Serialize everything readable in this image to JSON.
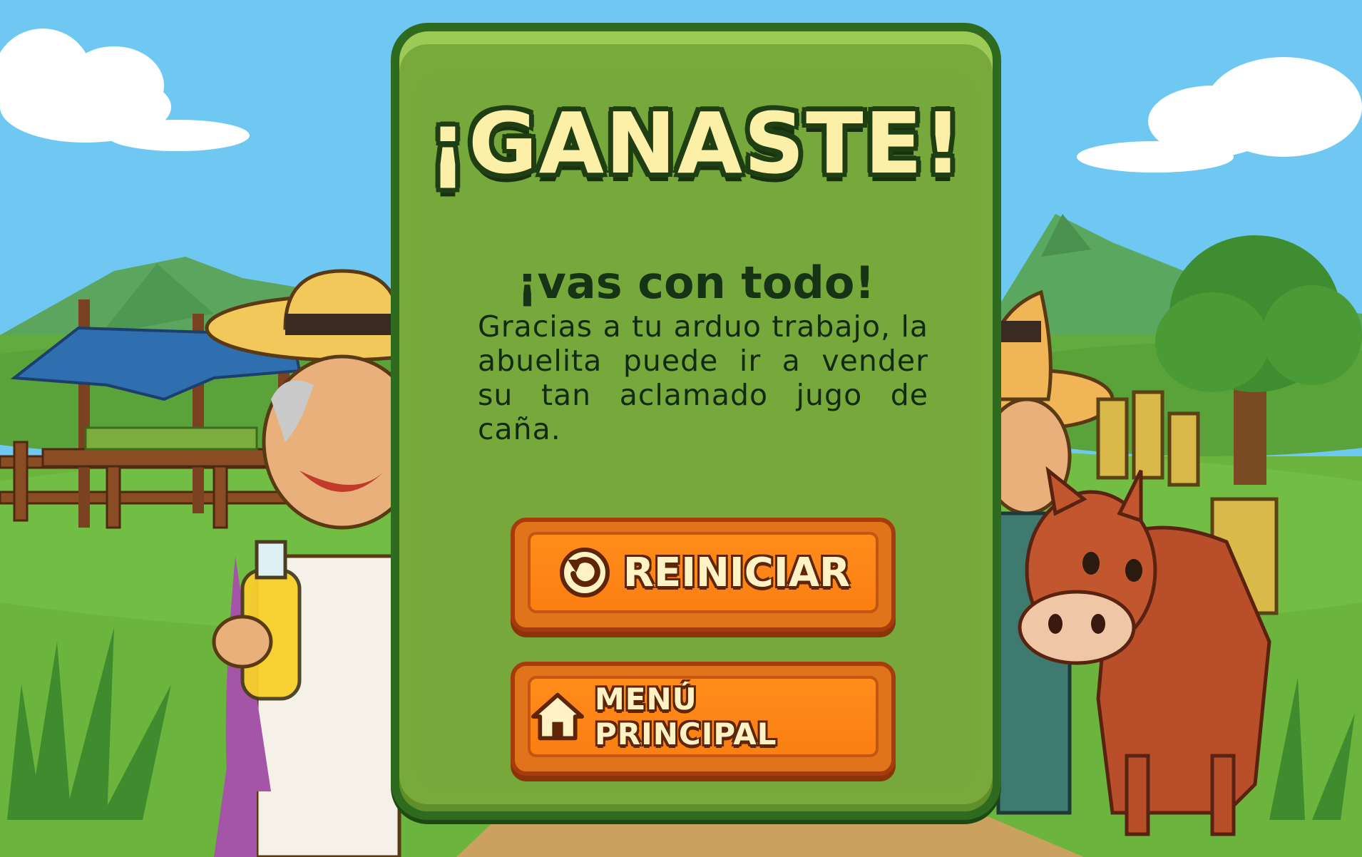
{
  "end_screen": {
    "title": "¡GANASTE!",
    "subtitle": "¡vas con todo!",
    "message": "Gracias a tu arduo trabajo, la abuelita puede ir a vender su tan aclamado jugo de caña."
  },
  "buttons": {
    "restart": {
      "label": "REINICIAR",
      "icon": "restart-icon"
    },
    "main_menu": {
      "label": "MENÚ PRINCIPAL",
      "icon": "home-icon"
    }
  },
  "colors": {
    "sky": "#6cc7f0",
    "panel": "#78a93a",
    "panel_border": "#2f6b1f",
    "title_fill": "#fcf0a8",
    "button": "#ff8c1a",
    "button_border": "#a63c0d"
  }
}
